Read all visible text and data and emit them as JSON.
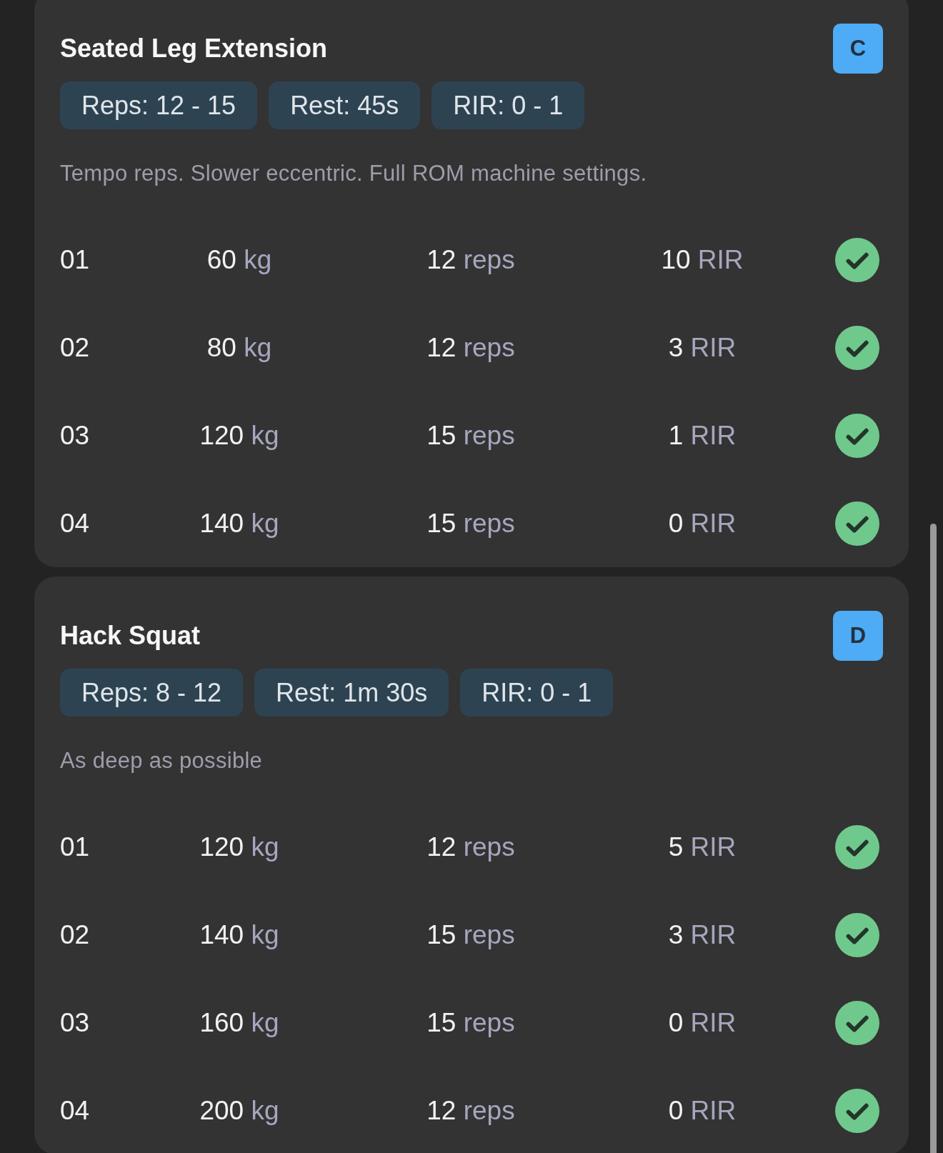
{
  "exercises": [
    {
      "name": "Seated Leg Extension",
      "badge": "C",
      "chips": [
        "Reps: 12 - 15",
        "Rest: 45s",
        "RIR: 0 - 1"
      ],
      "note": "Tempo reps. Slower eccentric. Full ROM machine settings.",
      "sets": [
        {
          "number": "01",
          "weight": "60",
          "weight_unit": "kg",
          "reps": "12",
          "reps_unit": "reps",
          "rir": "10",
          "rir_unit": "RIR",
          "completed": true
        },
        {
          "number": "02",
          "weight": "80",
          "weight_unit": "kg",
          "reps": "12",
          "reps_unit": "reps",
          "rir": "3",
          "rir_unit": "RIR",
          "completed": true
        },
        {
          "number": "03",
          "weight": "120",
          "weight_unit": "kg",
          "reps": "15",
          "reps_unit": "reps",
          "rir": "1",
          "rir_unit": "RIR",
          "completed": true
        },
        {
          "number": "04",
          "weight": "140",
          "weight_unit": "kg",
          "reps": "15",
          "reps_unit": "reps",
          "rir": "0",
          "rir_unit": "RIR",
          "completed": true
        }
      ]
    },
    {
      "name": "Hack Squat",
      "badge": "D",
      "chips": [
        "Reps: 8 - 12",
        "Rest: 1m 30s",
        "RIR: 0 - 1"
      ],
      "note": "As deep as possible",
      "sets": [
        {
          "number": "01",
          "weight": "120",
          "weight_unit": "kg",
          "reps": "12",
          "reps_unit": "reps",
          "rir": "5",
          "rir_unit": "RIR",
          "completed": true
        },
        {
          "number": "02",
          "weight": "140",
          "weight_unit": "kg",
          "reps": "15",
          "reps_unit": "reps",
          "rir": "3",
          "rir_unit": "RIR",
          "completed": true
        },
        {
          "number": "03",
          "weight": "160",
          "weight_unit": "kg",
          "reps": "15",
          "reps_unit": "reps",
          "rir": "0",
          "rir_unit": "RIR",
          "completed": true
        },
        {
          "number": "04",
          "weight": "200",
          "weight_unit": "kg",
          "reps": "12",
          "reps_unit": "reps",
          "rir": "0",
          "rir_unit": "RIR",
          "completed": true
        }
      ]
    }
  ]
}
